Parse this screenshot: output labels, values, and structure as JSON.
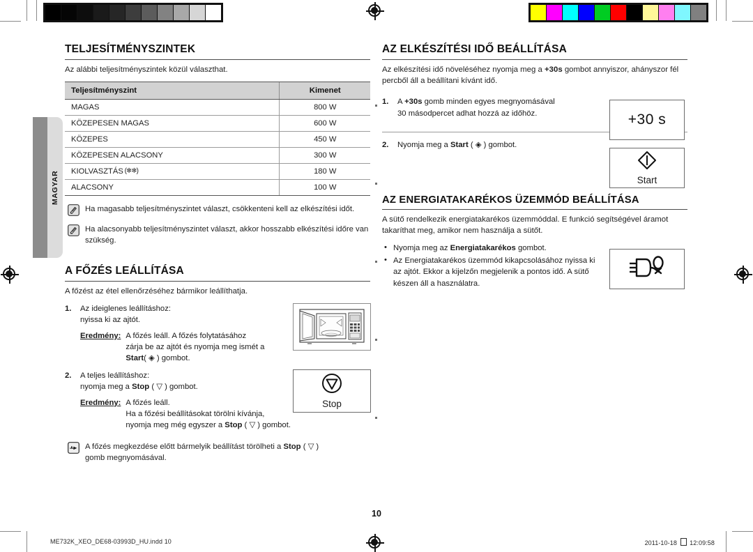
{
  "document": {
    "language_tab": "MAGYAR",
    "page_number": "10",
    "footer_left": "ME732K_XEO_DE68-03993D_HU.indd   10",
    "footer_right_date": "2011-10-18",
    "footer_right_time": "12:09:58"
  },
  "color_bars": {
    "grayscale": [
      "#000000",
      "#050505",
      "#0d0d0d",
      "#1a1a1a",
      "#262626",
      "#3d3d3d",
      "#5c5c5c",
      "#828282",
      "#a8a8a8",
      "#d6d6d6",
      "#ffffff"
    ],
    "color": [
      "#ffff00",
      "#ff00ff",
      "#00ffff",
      "#0000ff",
      "#00cc22",
      "#ff0000",
      "#000000",
      "#fff799",
      "#ff7ff0",
      "#7ff7ff",
      "#808080"
    ]
  },
  "left_column": {
    "power_section": {
      "title": "TELJESÍTMÉNYSZINTEK",
      "lead": "Az alábbi teljesítményszintek közül választhat.",
      "table": {
        "headers": [
          "Teljesítményszint",
          "Kimenet"
        ],
        "rows": [
          {
            "level": "MAGAS",
            "glyph": "",
            "output": "800 W"
          },
          {
            "level": "KÖZEPESEN MAGAS",
            "glyph": "",
            "output": "600 W"
          },
          {
            "level": "KÖZEPES",
            "glyph": "",
            "output": "450 W"
          },
          {
            "level": "KÖZEPESEN ALACSONY",
            "glyph": "",
            "output": "300 W"
          },
          {
            "level": "KIOLVASZTÁS",
            "glyph": "(❄❄)",
            "output": "180 W"
          },
          {
            "level": "ALACSONY",
            "glyph": "",
            "output": "100 W"
          }
        ]
      },
      "notes": [
        "Ha magasabb teljesítményszintet választ, csökkenteni kell az elkészítési időt.",
        "Ha alacsonyabb teljesítményszintet választ, akkor hosszabb elkészítési időre van szükség."
      ]
    },
    "stop_section": {
      "title": "A FŐZÉS LEÁLLÍTÁSA",
      "lead": "A főzést az étel ellenőrzéséhez bármikor leállíthatja.",
      "steps": [
        {
          "num": "1.",
          "text_line1": "Az ideiglenes leállításhoz:",
          "text_line2": "nyissa ki az ajtót.",
          "result_label": "Eredmény:",
          "result_line1": "A főzés leáll. A főzés folytatásához",
          "result_line2": "zárja be az ajtót és nyomja meg ismét a",
          "result_line3_bold": "Start",
          "result_line3_rest": "( ◈ ) gombot."
        },
        {
          "num": "2.",
          "text_line1": "A teljes leállításhoz:",
          "text_line2_pre": "nyomja meg a ",
          "text_line2_bold": "Stop",
          "text_line2_post": " ( ▽ ) gombot.",
          "result_label": "Eredmény:",
          "result_line1": "A főzés leáll.",
          "result_line2": "Ha a főzési beállításokat törölni kívánja,",
          "result_line3_pre": "nyomja meg még egyszer a ",
          "result_line3_bold": "Stop",
          "result_line3_post": " ( ▽ ) gombot."
        }
      ],
      "tip_pre": "A főzés megkezdése előtt bármelyik beállítást törölheti a ",
      "tip_bold": "Stop",
      "tip_post": " ( ▽ )",
      "tip_line2": "gomb megnyomásával.",
      "stop_key_label": "Stop"
    }
  },
  "right_column": {
    "cooking_time_section": {
      "title": "AZ ELKÉSZÍTÉSI IDŐ BEÁLLÍTÁSA",
      "lead_pre": "Az elkészítési idő növeléséhez nyomja meg a ",
      "lead_bold": "+30s",
      "lead_post": " gombot annyiszor, ahányszor fél percből áll a beállítani kívánt idő.",
      "steps": [
        {
          "num": "1.",
          "pre": "A ",
          "bold": "+30s",
          "post": " gomb minden egyes megnyomásával",
          "line2": "30 másodpercet adhat hozzá az időhöz."
        },
        {
          "num": "2.",
          "pre": "Nyomja meg a ",
          "bold": "Start",
          "post": " ( ◈ ) gombot."
        }
      ],
      "key_plus30_label": "+30 s",
      "key_start_label": "Start"
    },
    "eco_section": {
      "title": "AZ ENERGIATAKARÉKOS ÜZEMMÓD BEÁLLÍTÁSA",
      "lead": "A sütő rendelkezik energiatakarékos üzemmóddal. E funkció segítségével áramot takaríthat meg, amikor nem használja a sütőt.",
      "bullets": [
        {
          "pre": "Nyomja meg az ",
          "bold": "Energiatakarékos",
          "post": " gombot."
        },
        {
          "pre": "Az Energiatakarékos üzemmód kikapcsolásához nyissa ki az ajtót. Ekkor a kijelzőn megjelenik a pontos idő. A sütő készen áll a használatra.",
          "bold": "",
          "post": ""
        }
      ]
    }
  },
  "icons": {
    "note": "note-pencil-icon",
    "tip": "pointing-hand-icon",
    "eco": "power-plug-icon",
    "start": "start-diamond-icon",
    "stop": "stop-triangle-icon",
    "microwave": "microwave-oven-icon",
    "registration": "registration-mark-icon"
  }
}
